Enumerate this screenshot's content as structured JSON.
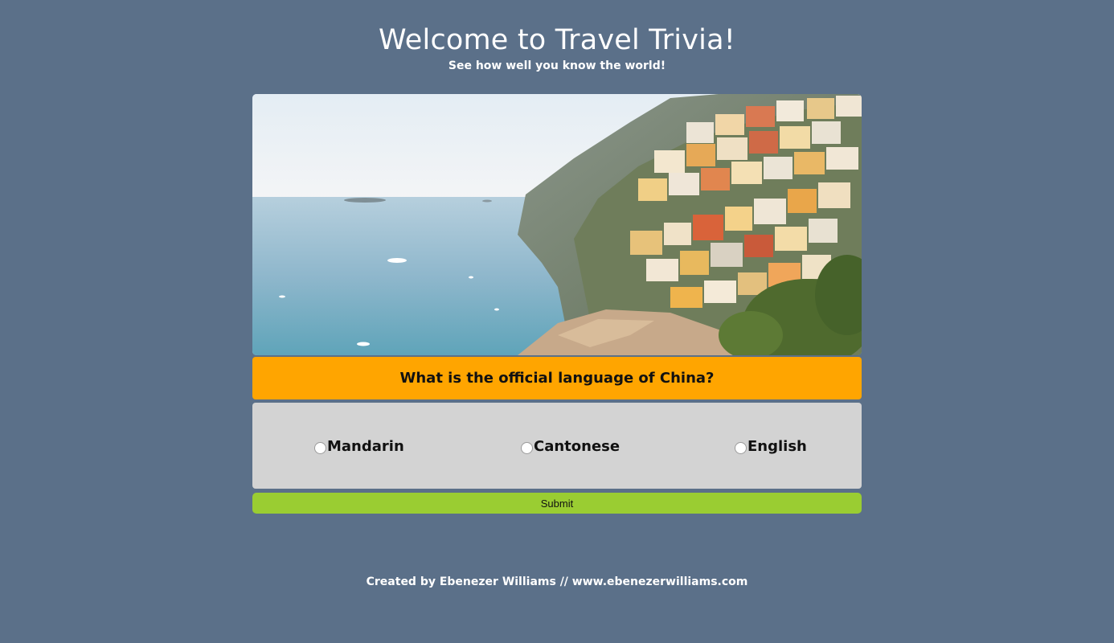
{
  "header": {
    "title": "Welcome to Travel Trivia!",
    "subtitle": "See how well you know the world!"
  },
  "image": {
    "subject": "coastal-town-photo"
  },
  "quiz": {
    "question": "What is the official language of China?",
    "options": [
      "Mandarin",
      "Cantonese",
      "English"
    ],
    "submit_label": "Submit"
  },
  "footer": {
    "credit": "Created by Ebenezer Williams // www.ebenezerwilliams.com"
  },
  "colors": {
    "background": "#5b7089",
    "question_bar": "#ffa500",
    "answers_panel": "#d3d3d3",
    "submit_button": "#9acd32"
  }
}
